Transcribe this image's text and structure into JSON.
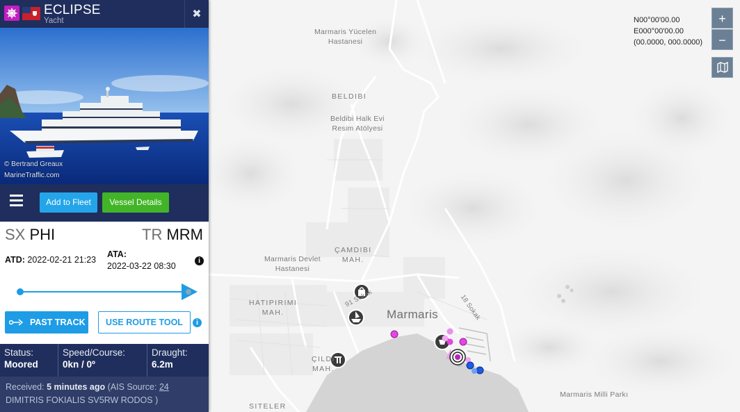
{
  "vessel": {
    "name": "ECLIPSE",
    "type": "Yacht",
    "type_icon": "ship-wheel-icon",
    "flag": "bermuda-flag"
  },
  "photo": {
    "credit_line1": "© Bertrand Greaux",
    "credit_line2": "MarineTraffic.com"
  },
  "actions": {
    "add_fleet": "Add to Fleet",
    "vessel_details": "Vessel Details"
  },
  "route": {
    "departure_country": "SX",
    "departure_port": "PHI",
    "arrival_country": "TR",
    "arrival_port": "MRM",
    "atd_label": "ATD:",
    "atd_value": "2022-02-21 21:23",
    "ata_label": "ATA:",
    "ata_value": "2022-03-22 08:30",
    "past_track": "PAST TRACK",
    "route_tool": "USE ROUTE TOOL"
  },
  "stats": {
    "status_label": "Status:",
    "status_value": "Moored",
    "speed_label": "Speed/Course:",
    "speed_value": "0kn / 0º",
    "draught_label": "Draught:",
    "draught_value": "6.2m"
  },
  "received": {
    "prefix": "Received:",
    "time": "5 minutes ago",
    "source_prefix": "(AIS Source:",
    "source_id": "24",
    "source_name": "DIMITRIS FOKIALIS SV5RW RODOS )"
  },
  "map": {
    "coord_line1": "N00°00'00.00",
    "coord_line2": "E000°00'00.00",
    "coord_line3": "(00.0000, 000.0000)",
    "zoom_in": "+",
    "zoom_out": "−",
    "labels": {
      "hospital1_l1": "Marmaris Yücelen",
      "hospital1_l2": "Hastanesi",
      "beldibi": "BELDIBI",
      "halk_l1": "Beldibi Halk Evi",
      "halk_l2": "Resim Atölyesi",
      "camdibi_l1": "ÇAMDIBI",
      "camdibi_l2": "MAH.",
      "devlet_l1": "Marmaris Devlet",
      "devlet_l2": "Hastanesi",
      "hatipirimi_l1": "HATIPIRIMI",
      "hatipirimi_l2": "MAH.",
      "marmaris": "Marmaris",
      "street1": "91 Sokak",
      "street2": "18 Sokak",
      "cil_l1": "ÇILDI",
      "cil_l2": "MAH.",
      "siteler": "SITELER",
      "milli_park": "Marmaris Milli Parkı"
    }
  },
  "colors": {
    "panel_navy": "#1f2e5c",
    "accent_blue": "#1e9ce6",
    "green": "#41b527",
    "yacht_magenta": "#c11fc0"
  }
}
